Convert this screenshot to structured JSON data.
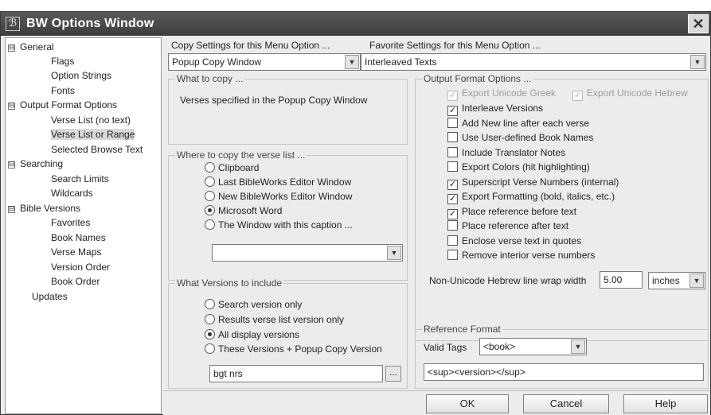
{
  "window": {
    "title": "BW Options Window",
    "icon_glyph": "ℬ",
    "close_glyph": "✕"
  },
  "tree": {
    "items": [
      {
        "label": "General",
        "expander": "⊟",
        "level": 0
      },
      {
        "label": "Flags",
        "level": 1
      },
      {
        "label": "Option Strings",
        "level": 1
      },
      {
        "label": "Fonts",
        "level": 1
      },
      {
        "label": "Output Format Options",
        "expander": "⊟",
        "level": 0
      },
      {
        "label": "Verse List (no text)",
        "level": 1
      },
      {
        "label": "Verse List or Range",
        "level": 1,
        "selected": true
      },
      {
        "label": "Selected Browse Text",
        "level": 1
      },
      {
        "label": "Searching",
        "expander": "⊟",
        "level": 0
      },
      {
        "label": "Search Limits",
        "level": 1
      },
      {
        "label": "Wildcards",
        "level": 1
      },
      {
        "label": "Bible Versions",
        "expander": "⊟",
        "level": 0
      },
      {
        "label": "Favorites",
        "level": 1
      },
      {
        "label": "Book Names",
        "level": 1
      },
      {
        "label": "Verse Maps",
        "level": 1
      },
      {
        "label": "Version Order",
        "level": 1
      },
      {
        "label": "Book Order",
        "level": 1
      },
      {
        "label": "Updates",
        "level": 0
      }
    ]
  },
  "copy_settings": {
    "label": "Copy Settings for this Menu Option ...",
    "value": "Popup Copy Window"
  },
  "favorite_settings": {
    "label": "Favorite Settings for this Menu Option ...",
    "value": "Interleaved Texts"
  },
  "what_to_copy": {
    "title": "What to copy ...",
    "text": "Verses specified in the Popup Copy Window"
  },
  "where_to_copy": {
    "title": "Where to copy the verse list ...",
    "options": [
      {
        "label": "Clipboard",
        "selected": false
      },
      {
        "label": "Last BibleWorks Editor Window",
        "selected": false
      },
      {
        "label": "New BibleWorks Editor Window",
        "selected": false
      },
      {
        "label": "Microsoft Word",
        "selected": true
      },
      {
        "label": "The Window with this caption ...",
        "selected": false
      }
    ],
    "caption_value": ""
  },
  "versions": {
    "title": "What Versions to include",
    "options": [
      {
        "label": "Search version only",
        "selected": false
      },
      {
        "label": "Results verse list version only",
        "selected": false
      },
      {
        "label": "All display versions",
        "selected": true
      },
      {
        "label": "These Versions + Popup Copy Version",
        "selected": false
      }
    ],
    "versions_value": "bgt nrs",
    "browse_label": "..."
  },
  "output_format": {
    "title": "Output Format Options ...",
    "unicode_greek": "Export Unicode Greek",
    "unicode_hebrew": "Export Unicode Hebrew",
    "options": [
      {
        "label": "Interleave Versions",
        "checked": true
      },
      {
        "label": "Add New line after each verse",
        "checked": false
      },
      {
        "label": "Use User-defined Book Names",
        "checked": false
      },
      {
        "label": "Include Translator Notes",
        "checked": false
      },
      {
        "label": "Export Colors (hit highlighting)",
        "checked": false
      },
      {
        "label": "Superscript Verse Numbers (internal)",
        "checked": true
      },
      {
        "label": "Export Formatting (bold, italics, etc.)",
        "checked": true
      },
      {
        "label": "Place reference before text",
        "checked": true
      },
      {
        "label": "Place reference after text",
        "checked": false
      },
      {
        "label": "Enclose verse text in quotes",
        "checked": false
      },
      {
        "label": "Remove interior verse numbers",
        "checked": false
      }
    ],
    "wrap_label": "Non-Unicode Hebrew line wrap width",
    "wrap_value": "5.00",
    "wrap_unit": "inches"
  },
  "reference_format": {
    "title": "Reference Format",
    "valid_tags_label": "Valid Tags",
    "valid_tags_value": "<book>",
    "format_value": "<sup><version></sup>"
  },
  "buttons": {
    "ok": "OK",
    "cancel": "Cancel",
    "help": "Help"
  },
  "glyphs": {
    "check": "✓",
    "dropdown": "▼"
  }
}
